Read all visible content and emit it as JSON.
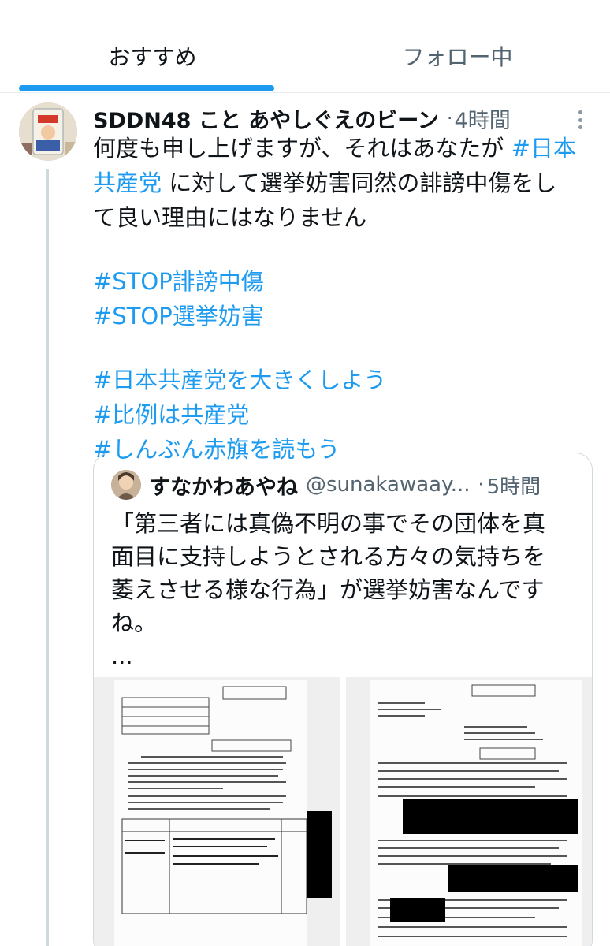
{
  "tabs": [
    {
      "label": "おすすめ",
      "active": true
    },
    {
      "label": "フォロー中",
      "active": false
    }
  ],
  "colors": {
    "accent": "#1d9bf0",
    "text": "#0f1419",
    "muted": "#536471",
    "border": "#cfd9de"
  },
  "tweet": {
    "display_name": "SDDN48 こと あやしぐえのビーン",
    "time": "4時間",
    "body": {
      "p1_a": "何度も申し上げますが、それはあなたが",
      "p1_tag": "#日本",
      "p1_tag_cont": "共産党",
      "p1_b": "に対して選挙妨害同然の誹謗中傷をし",
      "p1_c": "て良い理由にはなりません"
    },
    "hashtags_1": [
      "#STOP誹謗中傷",
      "#STOP選挙妨害"
    ],
    "hashtags_2": [
      "#日本共産党を大きくしよう",
      "#比例は共産党",
      "#しんぶん赤旗を読もう"
    ],
    "more_icon": "more-vertical-icon"
  },
  "quote": {
    "display_name": "すなかわあやね",
    "handle": "@sunakawaay...",
    "time": "5時間",
    "lines": [
      "「第三者には真偽不明の事でその団体を真",
      "面目に支持しようとされる方々の気持ちを",
      "萎えさせる様な行為」が選挙妨害なんですね",
      "ね。"
    ],
    "ellipsis": "..."
  }
}
